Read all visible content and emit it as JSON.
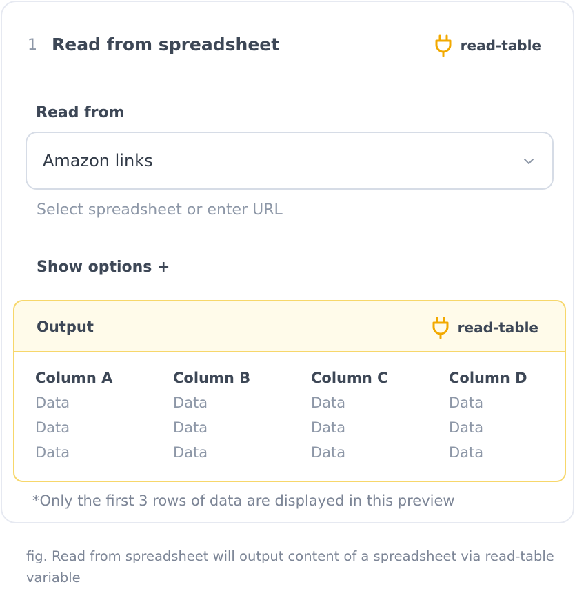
{
  "step": {
    "number": "1",
    "title": "Read from spreadsheet",
    "variable": "read-table"
  },
  "form": {
    "label": "Read from",
    "select_value": "Amazon links",
    "hint": "Select spreadsheet or enter URL",
    "show_options": "Show options +"
  },
  "output": {
    "title": "Output",
    "variable": "read-table",
    "columns": [
      "Column A",
      "Column B",
      "Column C",
      "Column D"
    ],
    "rows": [
      [
        "Data",
        "Data",
        "Data",
        "Data"
      ],
      [
        "Data",
        "Data",
        "Data",
        "Data"
      ],
      [
        "Data",
        "Data",
        "Data",
        "Data"
      ]
    ]
  },
  "footnote": "*Only the first 3 rows of data are displayed in this preview",
  "caption": "fig. Read from spreadsheet will output content of a spreadsheet via read-table variable",
  "colors": {
    "accent": "#f2a900",
    "output_border": "#f7d76b",
    "output_header_bg": "#fffbea",
    "text_primary": "#3d4756",
    "text_muted": "#8d97a7"
  }
}
